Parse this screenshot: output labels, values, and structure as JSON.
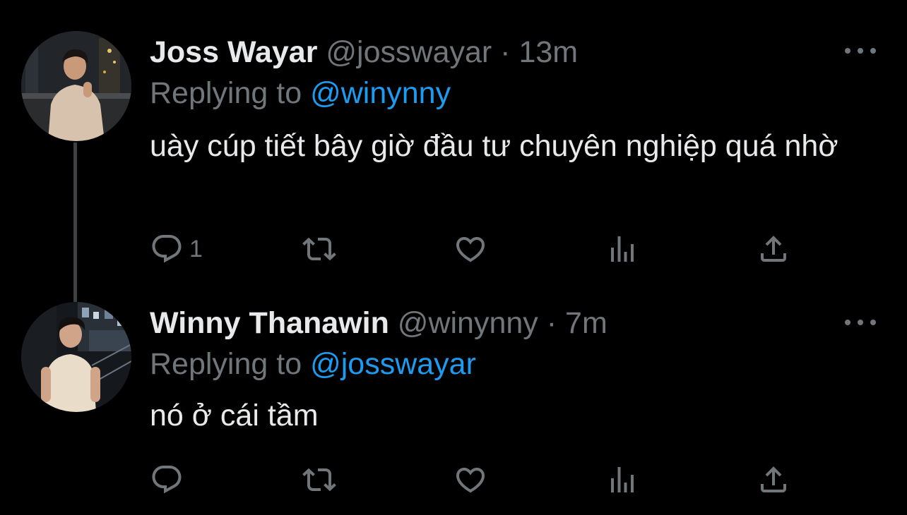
{
  "tweets": [
    {
      "name": "Joss Wayar",
      "handle": "@josswayar",
      "separator": "·",
      "time": "13m",
      "replying_prefix": "Replying to",
      "replying_to": "@winynny",
      "text": "uày cúp tiết bây giờ đầu tư chuyên nghiệp quá nhờ",
      "reply_count": "1",
      "avatar_icon": "profile-photo-city-night"
    },
    {
      "name": "Winny Thanawin",
      "handle": "@winynny",
      "separator": "·",
      "time": "7m",
      "replying_prefix": "Replying to",
      "replying_to": "@josswayar",
      "text": "nó ở cái tầm",
      "reply_count": "",
      "avatar_icon": "profile-photo-rooftop"
    }
  ],
  "colors": {
    "background": "#000000",
    "primary_text": "#e7e9ea",
    "secondary_text": "#71767b",
    "accent": "#1d9bf0",
    "thread_line": "#3e4144"
  },
  "icons": {
    "reply": "reply-icon",
    "retweet": "retweet-icon",
    "like": "heart-icon",
    "views": "views-icon",
    "share": "share-icon",
    "more": "more-icon"
  }
}
